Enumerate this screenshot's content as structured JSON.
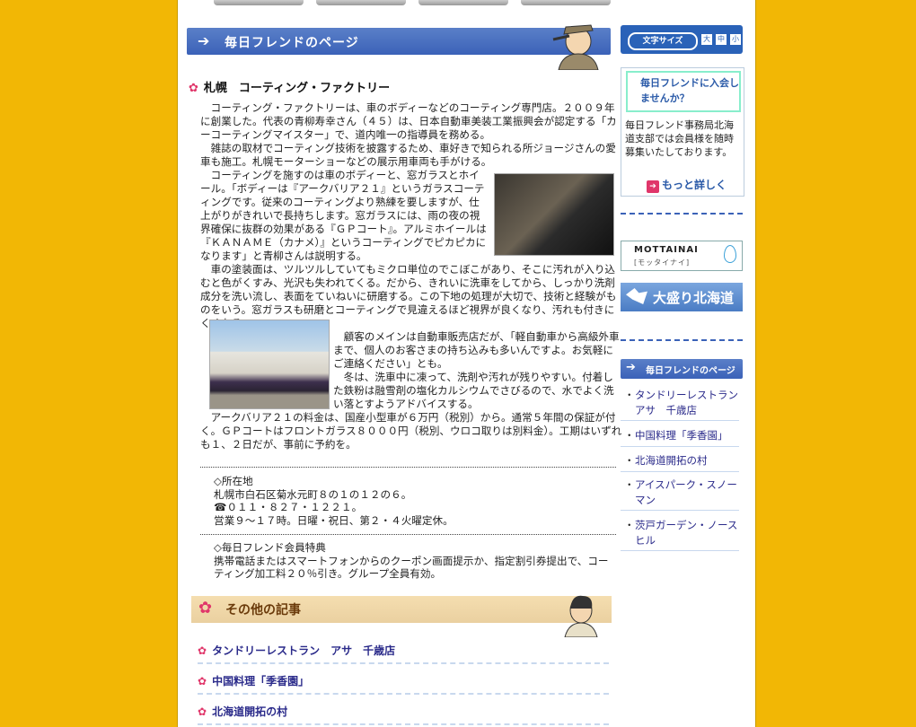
{
  "main": {
    "banner_text": "毎日フレンドのページ",
    "article_title": "札幌　コーティング・ファクトリー",
    "paragraphs": [
      "　コーティング・ファクトリーは、車のボディーなどのコーティング専門店。２００９年に創業した。代表の青柳寿幸さん（４５）は、日本自動車美装工業振興会が認定する「カーコーティングマイスター」で、道内唯一の指導員を務める。",
      "　雑誌の取材でコーティング技術を披露するため、車好きで知られる所ジョージさんの愛車も施工。札幌モーターショーなどの展示用車両も手がける。",
      "　コーティングを施すのは車のボディーと、窓ガラスとホイール。「ボディーは『アークバリア２１』というガラスコーティングです。従来のコーティングより熟練を要しますが、仕上がりがきれいで長持ちします。窓ガラスには、雨の夜の視界確保に抜群の効果がある『ＧＰコート』。アルミホイールは『ＫＡＮＡＭＥ（カナメ）』というコーティングでピカピカになります」と青柳さんは説明する。",
      "　車の塗装面は、ツルツルしていてもミクロ単位のでこぼこがあり、そこに汚れが入り込むと色がくすみ、光沢も失われてくる。だから、きれいに洗車をしてから、しっかり洗剤成分を洗い流し、表面をていねいに研磨する。この下地の処理が大切で、技術と経験がものをいう。窓ガラスも研磨とコーティングで見違えるほど視界が良くなり、汚れも付きにくくなる。",
      "　顧客のメインは自動車販売店だが、「軽自動車から高級外車まで、個人のお客さまの持ち込みも多いんですよ。お気軽にご連絡ください」とも。",
      "　冬は、洗車中に凍って、洗剤や汚れが残りやすい。付着した鉄粉は融雪剤の塩化カルシウムでさびるので、水でよく洗い落とすようアドバイスする。",
      "　アークバリア２１の料金は、国産小型車が６万円（税別）から。通常５年間の保証が付く。ＧＰコートはフロントガラス８０００円（税別、ウロコ取りは別料金）。工期はいずれも１、２日だが、事前に予約を。"
    ],
    "info": {
      "label": "◇所在地",
      "address": "札幌市白石区菊水元町８の１の１２の６。",
      "phone": "☎０１１・８２７・１２２１。",
      "hours": "営業９～１７時。日曜・祝日、第２・４火曜定休。"
    },
    "benefit": {
      "label": "◇毎日フレンド会員特典",
      "text": "携帯電話またはスマートフォンからのクーポン画面提示か、指定割引券提出で、コーティング加工料２０％引き。グループ全員有効。"
    },
    "other_title": "その他の記事",
    "other_links": [
      "タンドリーレストラン　アサ　千歳店",
      "中国料理「季香園」",
      "北海道開拓の村"
    ]
  },
  "sidebar": {
    "font_size_label": "文字サイズ",
    "font_sizes": [
      "大",
      "中",
      "小"
    ],
    "join_title": "毎日フレンドに入会しませんか？",
    "join_text": "毎日フレンド事務局北海道支部では会員様を随時募集いたしております。",
    "more_label": "もっと詳しく",
    "mottainai": "MOTTAINAI",
    "mottainai_sub": "[モッタイナイ]",
    "hokkaido_banner": "大盛り北海道",
    "page_banner": "毎日フレンドのページ",
    "links": [
      "タンドリーレストラン アサ　千歳店",
      "中国料理「季香園」",
      "北海道開拓の村",
      "アイスパーク・スノーマン",
      "茨戸ガーデン・ノースヒル"
    ]
  },
  "colors": {
    "background": "#f2b705",
    "accent": "#3b62b8",
    "flower": "#e0366a"
  }
}
